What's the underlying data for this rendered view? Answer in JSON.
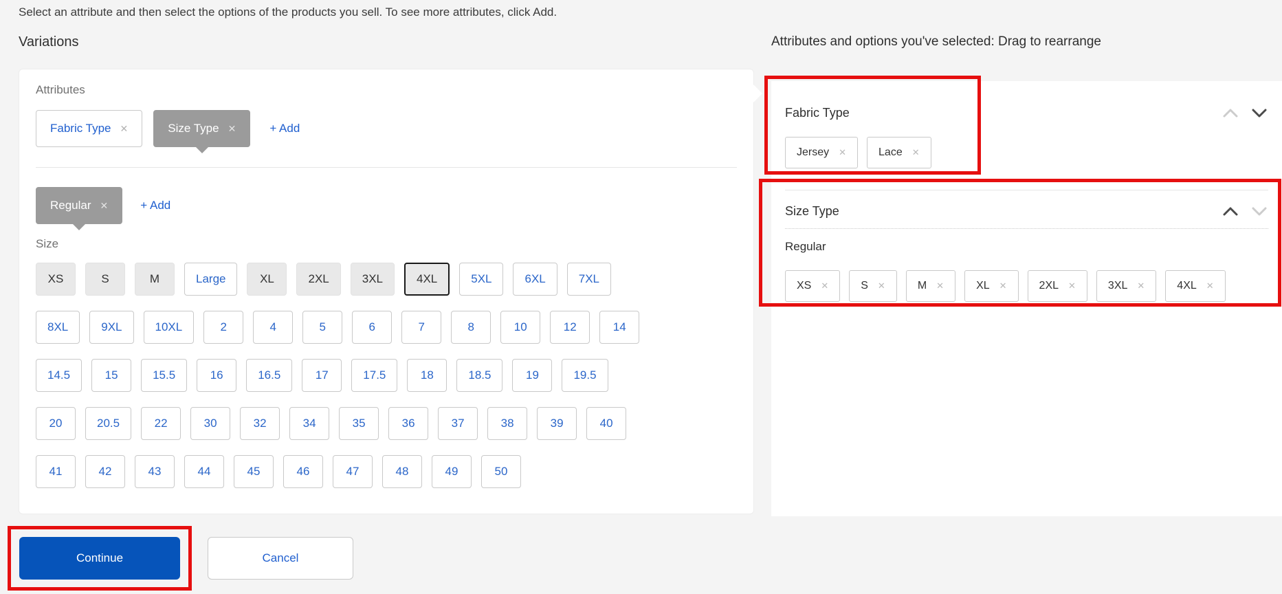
{
  "colors": {
    "page_bg": "#f4f4f4",
    "primary_blue": "#0654ba",
    "link_blue": "#2160cf",
    "selected_chip_gray": "#9b9b9b",
    "annotation_red": "#e60f0f"
  },
  "instruction": "Select an attribute and then select the options of the products you sell. To see more attributes, click Add.",
  "variations": {
    "title": "Variations",
    "attributes_label": "Attributes",
    "remove_glyph": "✕",
    "attribute_chips": [
      {
        "label": "Fabric Type",
        "selected": false
      },
      {
        "label": "Size Type",
        "selected": true
      }
    ],
    "add_attribute_label": "+ Add",
    "size_type_chips": [
      {
        "label": "Regular",
        "selected": true
      }
    ],
    "add_size_type_label": "+ Add",
    "size_section_label": "Size",
    "selected_sizes": [
      "XS",
      "S",
      "M",
      "XL",
      "2XL",
      "3XL",
      "4XL"
    ],
    "focused_size": "4XL",
    "size_rows": [
      [
        "XS",
        "S",
        "M",
        "Large",
        "XL",
        "2XL",
        "3XL",
        "4XL",
        "5XL",
        "6XL",
        "7XL"
      ],
      [
        "8XL",
        "9XL",
        "10XL",
        "2",
        "4",
        "5",
        "6",
        "7",
        "8",
        "10",
        "12",
        "14"
      ],
      [
        "14.5",
        "15",
        "15.5",
        "16",
        "16.5",
        "17",
        "17.5",
        "18",
        "18.5",
        "19",
        "19.5"
      ],
      [
        "20",
        "20.5",
        "22",
        "30",
        "32",
        "34",
        "35",
        "36",
        "37",
        "38",
        "39",
        "40"
      ],
      [
        "41",
        "42",
        "43",
        "44",
        "45",
        "46",
        "47",
        "48",
        "49",
        "50"
      ]
    ]
  },
  "selected_panel": {
    "heading": "Attributes and options you've selected: Drag to rearrange",
    "sections": [
      {
        "title": "Fabric Type",
        "move_up_enabled": false,
        "move_down_enabled": true,
        "options": [
          "Jersey",
          "Lace"
        ],
        "groups": []
      },
      {
        "title": "Size Type",
        "move_up_enabled": true,
        "move_down_enabled": false,
        "options": [],
        "groups": [
          {
            "label": "Regular",
            "options": [
              "XS",
              "S",
              "M",
              "XL",
              "2XL",
              "3XL",
              "4XL"
            ]
          }
        ]
      }
    ]
  },
  "footer": {
    "continue_label": "Continue",
    "cancel_label": "Cancel"
  }
}
